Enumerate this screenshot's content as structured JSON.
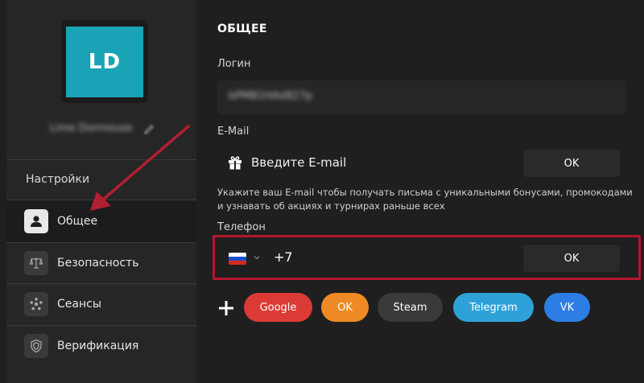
{
  "profile": {
    "initials": "LD",
    "username": "Lime Dormouse"
  },
  "sidebar": {
    "title": "Настройки",
    "items": [
      {
        "label": "Общее",
        "icon": "user-icon",
        "active": true
      },
      {
        "label": "Безопасность",
        "icon": "scales-icon",
        "active": false
      },
      {
        "label": "Сеансы",
        "icon": "sessions-icon",
        "active": false
      },
      {
        "label": "Верификация",
        "icon": "shield-icon",
        "active": false
      }
    ]
  },
  "main": {
    "title": "ОБЩЕЕ",
    "login": {
      "label": "Логин",
      "value": "bPMB1HAd827p"
    },
    "email": {
      "label": "E-Mail",
      "placeholder": "Введите E-mail",
      "ok_label": "OK",
      "hint": "Укажите ваш E-mail чтобы получать письма с уникальными бонусами, промокодами и узнавать об акциях и турнирах раньше всех"
    },
    "phone": {
      "label": "Телефон",
      "code": "+7",
      "ok_label": "OK"
    },
    "social": [
      {
        "label": "Google",
        "color": "#dc3b35"
      },
      {
        "label": "OK",
        "color": "#ee8a24"
      },
      {
        "label": "Steam",
        "color": "#3a3a3a"
      },
      {
        "label": "Telegram",
        "color": "#2ea2d8"
      },
      {
        "label": "VK",
        "color": "#2d7ee4"
      }
    ]
  },
  "colors": {
    "avatar": "#1aa3b6",
    "highlight": "#b3172e",
    "arrow": "#b01f33"
  }
}
